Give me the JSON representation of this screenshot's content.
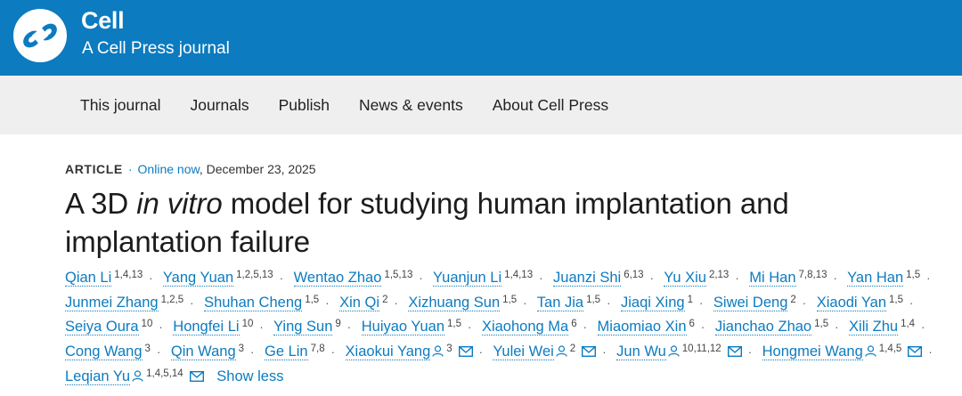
{
  "header": {
    "brand_name": "Cell",
    "brand_sub": "A Cell Press journal",
    "logo_icon": "cell-press-logo-icon",
    "bg_color": "#0c7bc0"
  },
  "nav": {
    "items": [
      {
        "label": "This journal"
      },
      {
        "label": "Journals"
      },
      {
        "label": "Publish"
      },
      {
        "label": "News & events"
      },
      {
        "label": "About Cell Press"
      }
    ]
  },
  "article": {
    "type": "ARTICLE",
    "status": "Online now",
    "date": ", December 23, 2025",
    "title_pre": "A 3D ",
    "title_italic": "in vitro",
    "title_post": " model for studying human implantation and implantation failure",
    "authors": [
      {
        "name": "Qian Li",
        "aff": "1,4,13"
      },
      {
        "name": "Yang Yuan",
        "aff": "1,2,5,13"
      },
      {
        "name": "Wentao Zhao",
        "aff": "1,5,13"
      },
      {
        "name": "Yuanjun Li",
        "aff": "1,4,13"
      },
      {
        "name": "Juanzi Shi",
        "aff": "6,13"
      },
      {
        "name": "Yu Xiu",
        "aff": "2,13"
      },
      {
        "name": "Mi Han",
        "aff": "7,8,13"
      },
      {
        "name": "Yan Han",
        "aff": "1,5"
      },
      {
        "name": "Junmei Zhang",
        "aff": "1,2,5"
      },
      {
        "name": "Shuhan Cheng",
        "aff": "1,5"
      },
      {
        "name": "Xin Qi",
        "aff": "2"
      },
      {
        "name": "Xizhuang Sun",
        "aff": "1,5"
      },
      {
        "name": "Tan Jia",
        "aff": "1,5"
      },
      {
        "name": "Jiaqi Xing",
        "aff": "1"
      },
      {
        "name": "Siwei Deng",
        "aff": "2"
      },
      {
        "name": "Xiaodi Yan",
        "aff": "1,5"
      },
      {
        "name": "Seiya Oura",
        "aff": "10"
      },
      {
        "name": "Hongfei Li",
        "aff": "10"
      },
      {
        "name": "Ying Sun",
        "aff": "9"
      },
      {
        "name": "Huiyao Yuan",
        "aff": "1,5"
      },
      {
        "name": "Xiaohong Ma",
        "aff": "6"
      },
      {
        "name": "Miaomiao Xin",
        "aff": "6"
      },
      {
        "name": "Jianchao Zhao",
        "aff": "1,5"
      },
      {
        "name": "Xili Zhu",
        "aff": "1,4"
      },
      {
        "name": "Cong Wang",
        "aff": "3"
      },
      {
        "name": "Qin Wang",
        "aff": "3"
      },
      {
        "name": "Ge Lin",
        "aff": "7,8"
      },
      {
        "name": "Xiaokui Yang",
        "aff": "3",
        "corresponding": true
      },
      {
        "name": "Yulei Wei",
        "aff": "2",
        "corresponding": true
      },
      {
        "name": "Jun Wu",
        "aff": "10,11,12",
        "corresponding": true
      },
      {
        "name": "Hongmei Wang",
        "aff": "1,4,5",
        "corresponding": true
      },
      {
        "name": "Leqian Yu",
        "aff": "1,4,5,14",
        "corresponding": true
      }
    ],
    "show_less_label": "Show less"
  }
}
